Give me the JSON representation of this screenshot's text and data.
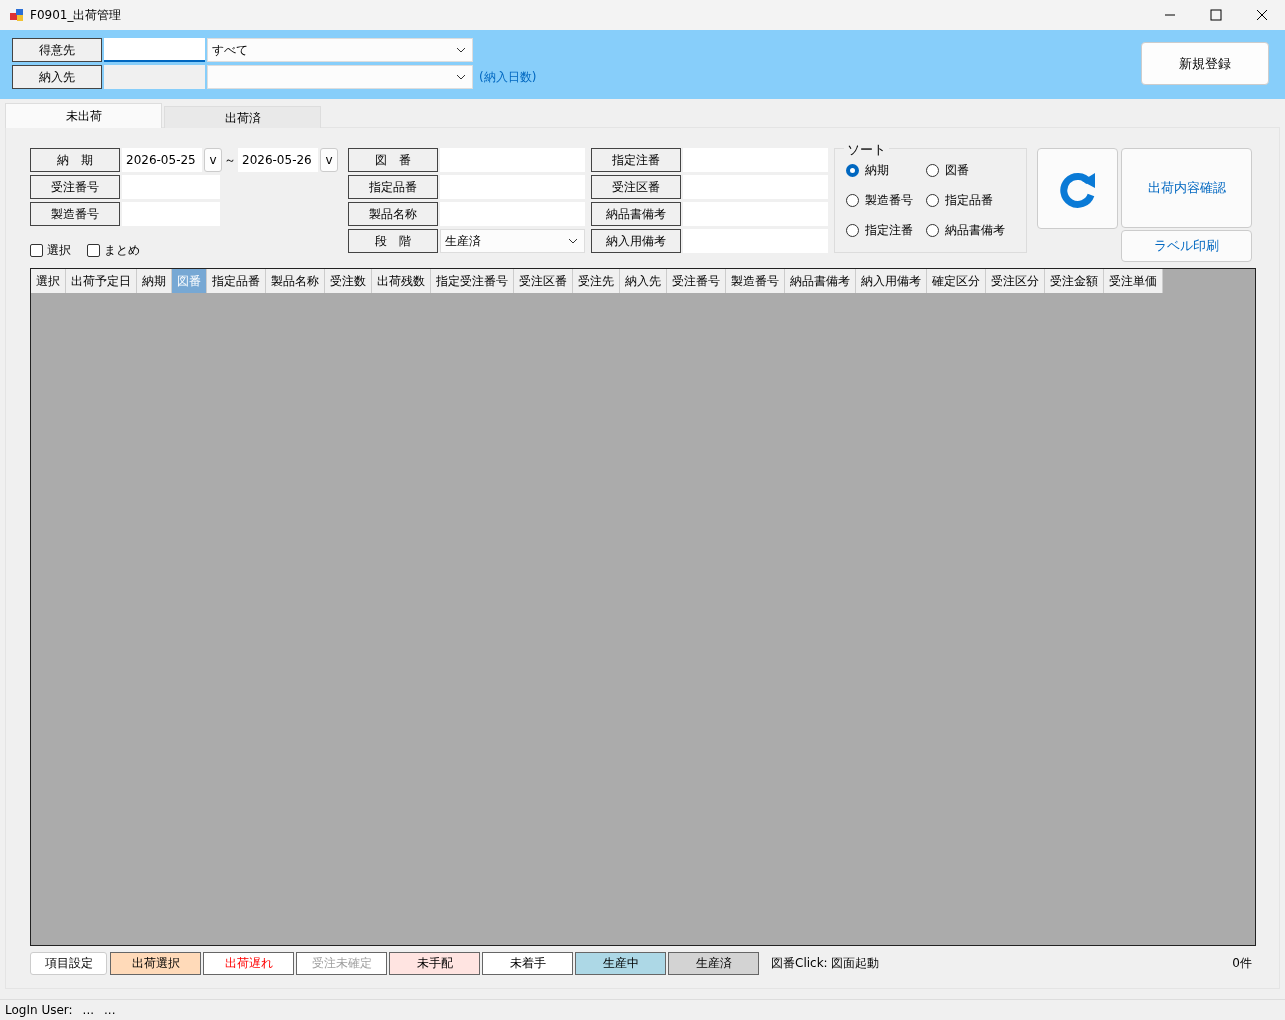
{
  "window": {
    "title": "F0901_出荷管理"
  },
  "header": {
    "customer": {
      "label": "得意先",
      "select": "すべて"
    },
    "delivery": {
      "label": "納入先",
      "note": "(納入日数)"
    },
    "new_button": "新規登録"
  },
  "tabs": [
    {
      "label": "未出荷",
      "selected": true
    },
    {
      "label": "出荷済",
      "selected": false
    }
  ],
  "filters": {
    "period": {
      "label": "納　期",
      "from": "2026-05-25",
      "to": "2026-05-26",
      "drop_from": "v",
      "drop_to": "v",
      "tilde": "～"
    },
    "left_fields": [
      {
        "label": "受注番号"
      },
      {
        "label": "製造番号"
      }
    ],
    "checkboxes": [
      {
        "label": "選択",
        "checked": false
      },
      {
        "label": "まとめ",
        "checked": false
      }
    ],
    "middle_fields": [
      {
        "label": "図　番",
        "kind": "text"
      },
      {
        "label": "指定品番",
        "kind": "text"
      },
      {
        "label": "製品名称",
        "kind": "text"
      },
      {
        "label": "段　階",
        "value": "生産済",
        "kind": "select"
      }
    ],
    "right_fields": [
      {
        "label": "指定注番"
      },
      {
        "label": "受注区番"
      },
      {
        "label": "納品書備考"
      },
      {
        "label": "納入用備考"
      }
    ]
  },
  "sort": {
    "title": "ソート",
    "options": [
      {
        "label": "納期",
        "selected": true
      },
      {
        "label": "図番",
        "selected": false
      },
      {
        "label": "製造番号",
        "selected": false
      },
      {
        "label": "指定品番",
        "selected": false
      },
      {
        "label": "指定注番",
        "selected": false
      },
      {
        "label": "納品書備考",
        "selected": false
      }
    ]
  },
  "actions": {
    "confirm": "出荷内容確認",
    "label_print": "ラベル印刷"
  },
  "table": {
    "columns": [
      {
        "label": "選択",
        "selected": false
      },
      {
        "label": "出荷予定日",
        "selected": false
      },
      {
        "label": "納期",
        "selected": false
      },
      {
        "label": "図番",
        "selected": true
      },
      {
        "label": "指定品番",
        "selected": false
      },
      {
        "label": "製品名称",
        "selected": false
      },
      {
        "label": "受注数",
        "selected": false
      },
      {
        "label": "出荷残数",
        "selected": false
      },
      {
        "label": "指定受注番号",
        "selected": false
      },
      {
        "label": "受注区番",
        "selected": false
      },
      {
        "label": "受注先",
        "selected": false
      },
      {
        "label": "納入先",
        "selected": false
      },
      {
        "label": "受注番号",
        "selected": false
      },
      {
        "label": "製造番号",
        "selected": false
      },
      {
        "label": "納品書備考",
        "selected": false
      },
      {
        "label": "納入用備考",
        "selected": false
      },
      {
        "label": "確定区分",
        "selected": false
      },
      {
        "label": "受注区分",
        "selected": false
      },
      {
        "label": "受注金額",
        "selected": false
      },
      {
        "label": "受注単価",
        "selected": false
      }
    ]
  },
  "legend": {
    "items": [
      {
        "label": "項目設定",
        "kind": "button"
      },
      {
        "label": "出荷選択",
        "kind": "swatch",
        "color": "#ffdab9"
      },
      {
        "label": "出荷遅れ",
        "kind": "alert",
        "color": "#ffffff"
      },
      {
        "label": "受注未確定",
        "kind": "muted",
        "color": "#ffffff"
      },
      {
        "label": "未手配",
        "kind": "swatch",
        "color": "#ffe4e1"
      },
      {
        "label": "未着手",
        "kind": "swatch",
        "color": "#ffffff"
      },
      {
        "label": "生産中",
        "kind": "swatch",
        "color": "#add8e6"
      },
      {
        "label": "生産済",
        "kind": "swatch",
        "color": "#d3d3d3"
      }
    ],
    "hint": "図番Click: 図面起動",
    "count": "0件"
  },
  "status_bar": {
    "label": "LogIn User:",
    "user": "...",
    "extra": "..."
  }
}
